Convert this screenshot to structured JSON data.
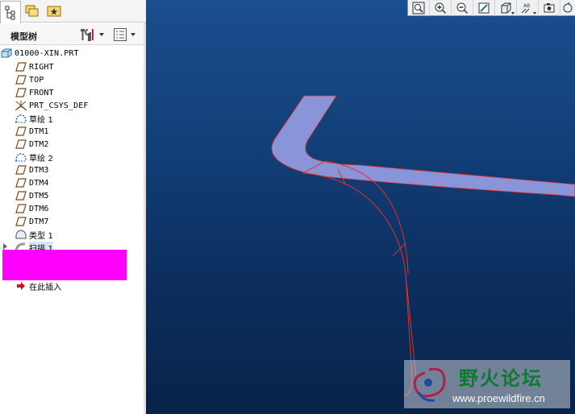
{
  "model_tree": {
    "title": "模型树",
    "root": "01000-XIN.PRT",
    "items": [
      {
        "label": "RIGHT",
        "icon": "datum-plane-icon"
      },
      {
        "label": "TOP",
        "icon": "datum-plane-icon"
      },
      {
        "label": "FRONT",
        "icon": "datum-plane-icon"
      },
      {
        "label": "PRT_CSYS_DEF",
        "icon": "coordinate-system-icon"
      },
      {
        "label": "草绘 1",
        "icon": "sketch-icon"
      },
      {
        "label": "DTM1",
        "icon": "datum-plane-icon"
      },
      {
        "label": "DTM2",
        "icon": "datum-plane-icon"
      },
      {
        "label": "草绘 2",
        "icon": "sketch-icon"
      },
      {
        "label": "DTM3",
        "icon": "datum-plane-icon"
      },
      {
        "label": "DTM4",
        "icon": "datum-plane-icon"
      },
      {
        "label": "DTM5",
        "icon": "datum-plane-icon"
      },
      {
        "label": "DTM6",
        "icon": "datum-plane-icon"
      },
      {
        "label": "DTM7",
        "icon": "datum-plane-icon"
      },
      {
        "label": "类型 1",
        "icon": "surface-feature-icon"
      },
      {
        "label": "扫描 1",
        "icon": "sweep-icon"
      }
    ],
    "insert_here": "在此插入"
  },
  "panel_tabs": [
    "model-tree-tab-icon",
    "folder-browser-tab-icon",
    "favorites-tab-icon"
  ],
  "toolbar": {
    "buttons": [
      "zoom-fit-icon",
      "zoom-in-icon",
      "zoom-out-icon",
      "repaint-icon",
      "display-style-icon",
      "annotation-display-icon",
      "saved-views-icon",
      "spin-center-icon"
    ]
  },
  "watermark": {
    "title": "野火论坛",
    "url": "www.proewildfire.cn"
  },
  "colors": {
    "viewport_top": "#1b4e8f",
    "viewport_bottom": "#082349",
    "surface_fill": "#8a94d8",
    "edge_red": "#e0312a",
    "redaction": "#ff00ff",
    "watermark_green": "#0c7a2f"
  }
}
